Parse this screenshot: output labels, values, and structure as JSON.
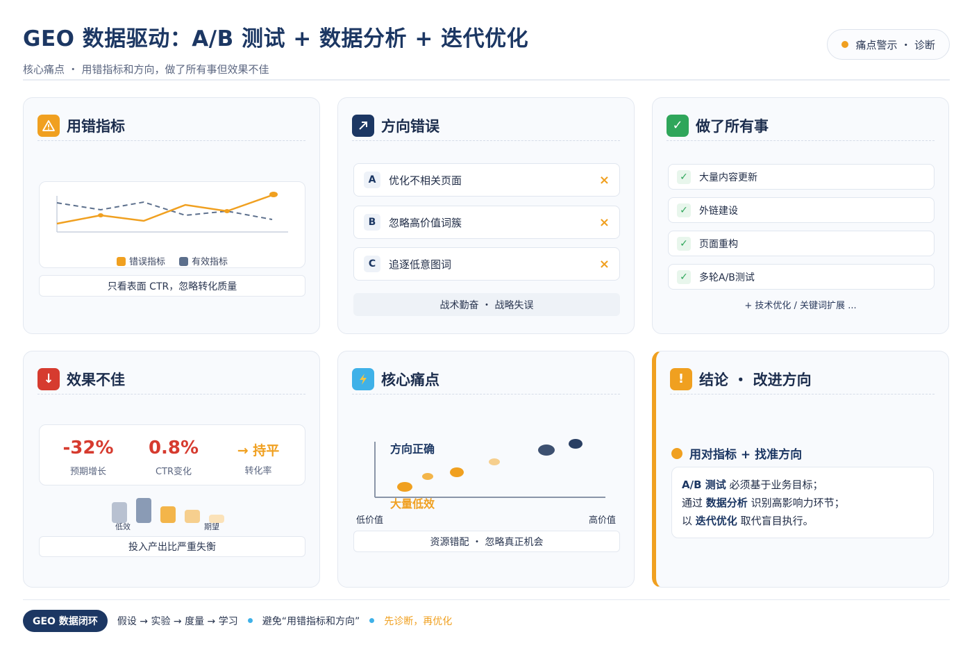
{
  "header": {
    "title": "GEO 数据驱动：A/B 测试 + 数据分析 + 迭代优化",
    "subtitle": "核心痛点 ・ 用错指标和方向，做了所有事但效果不佳",
    "pill_label": "痛点警示 ・ 诊断"
  },
  "cards": {
    "wrong_metrics": {
      "title": "用错指标",
      "icon": "warning-icon",
      "legend": [
        "错误指标",
        "有效指标"
      ],
      "caption": "只看表面 CTR，忽略转化质量",
      "colors": {
        "wrong": "#f0a020",
        "valid": "#5c6f8c"
      }
    },
    "wrong_direction": {
      "title": "方向错误",
      "icon": "trend-arrow-icon",
      "options": [
        {
          "letter": "A",
          "text": "优化不相关页面",
          "mark": "×"
        },
        {
          "letter": "B",
          "text": "忽略高价值词簇",
          "mark": "×"
        },
        {
          "letter": "C",
          "text": "追逐低意图词",
          "mark": "×"
        }
      ],
      "caption": "战术勤奋 ・ 战略失误"
    },
    "did_everything": {
      "title": "做了所有事",
      "icon": "check-icon",
      "items": [
        "大量内容更新",
        "外链建设",
        "页面重构",
        "多轮A/B测试"
      ],
      "more": "+ 技术优化 / 关键词扩展 ..."
    },
    "poor_results": {
      "title": "效果不佳",
      "icon": "down-arrow-icon",
      "stats": [
        {
          "value": "-32%",
          "label": "预期增长"
        },
        {
          "value": "0.8%",
          "label": "CTR变化"
        },
        {
          "value": "→ 持平",
          "label": "转化率"
        }
      ],
      "bar_labels": {
        "low": "低效",
        "expect": "期望"
      },
      "caption": "投入产出比严重失衡"
    },
    "core_pain": {
      "title": "核心痛点",
      "icon": "lightning-icon",
      "label_top": "方向正确",
      "label_bottom": "大量低效",
      "axis_left": "低价值",
      "axis_right": "高价值",
      "caption": "资源错配 ・ 忽略真正机会"
    },
    "conclusion": {
      "title": "结论 ・ 改进方向",
      "icon": "exclamation-icon",
      "headline": "用对指标 + 找准方向",
      "lines": [
        {
          "bold": "A/B 测试",
          "rest": "必须基于业务目标；"
        },
        {
          "pre": "通过 ",
          "bold": "数据分析",
          "rest": " 识别高影响力环节；"
        },
        {
          "pre": "以 ",
          "bold": "迭代优化",
          "rest": " 取代盲目执行。"
        }
      ]
    }
  },
  "footer": {
    "badge": "GEO 数据闭环",
    "flow": "假设 → 实验 → 度量 → 学习",
    "avoid": "避免“用错指标和方向”",
    "tip": "先诊断，再优化"
  }
}
